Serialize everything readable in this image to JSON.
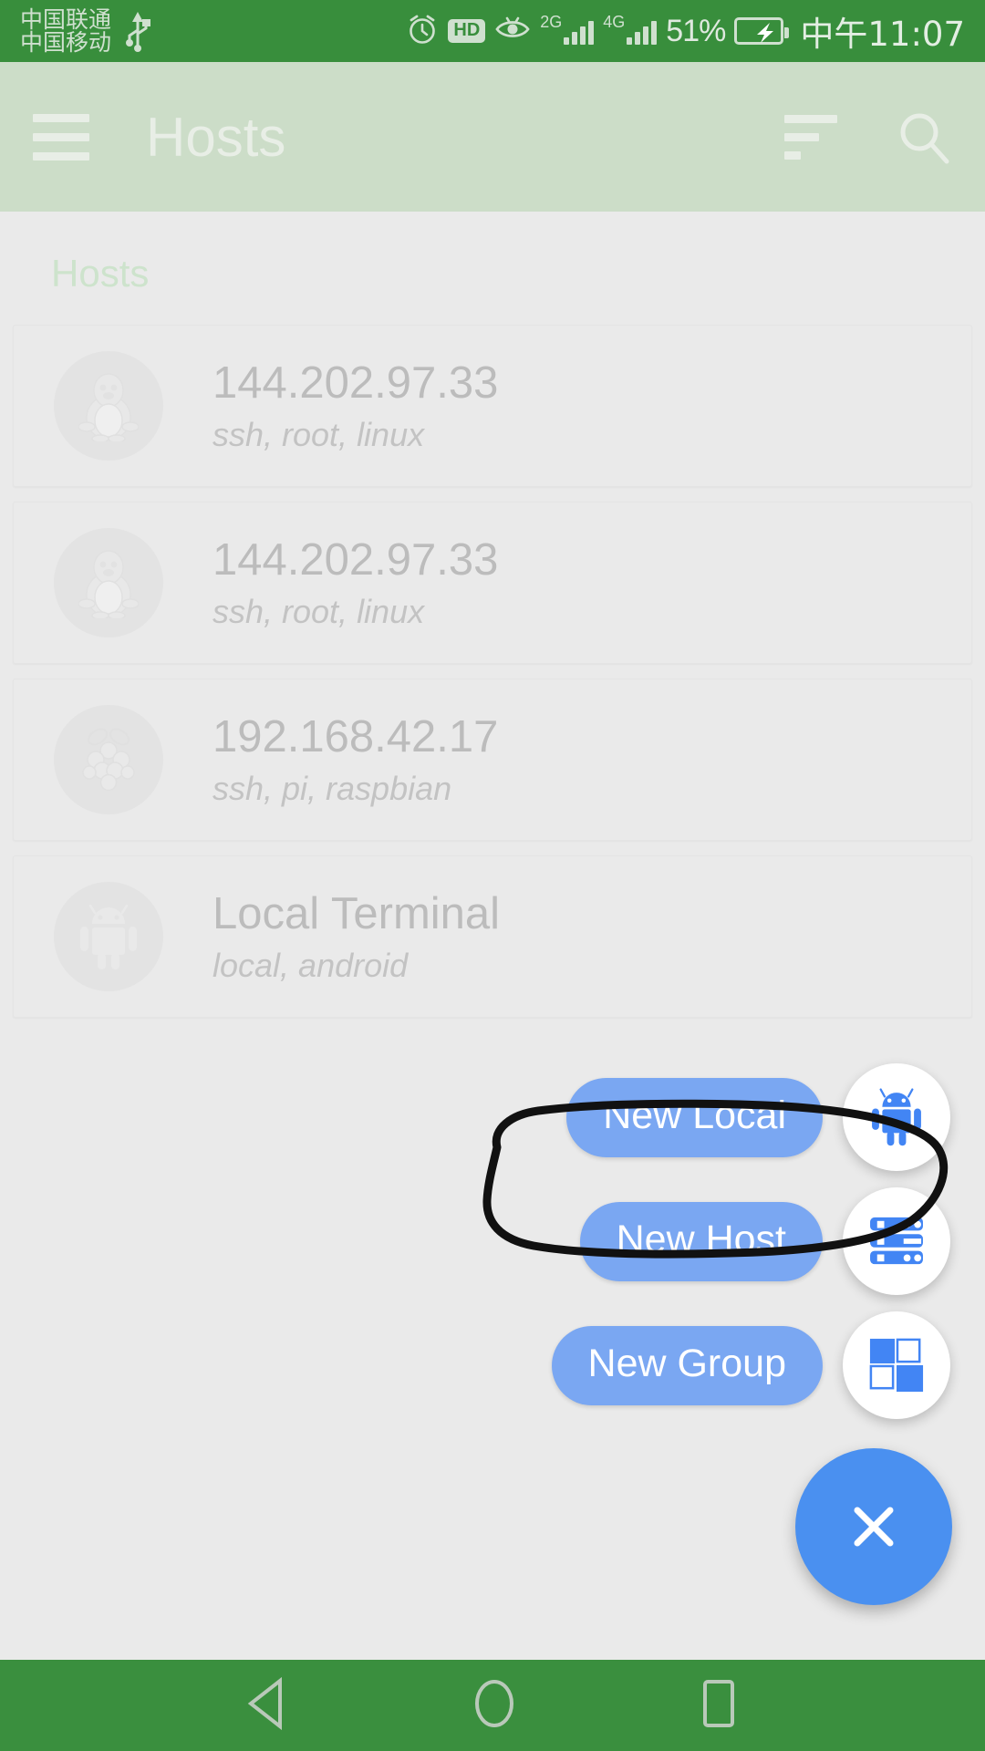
{
  "status_bar": {
    "carrier_primary": "中国联通",
    "carrier_secondary": "中国移动",
    "usb_icon": "usb-icon",
    "alarm_icon": "alarm-clock-icon",
    "hd_badge": "HD",
    "eye_icon": "eye-icon",
    "network_2g_label": "2G",
    "network_4g_label": "4G",
    "battery_percent": "51%",
    "battery_icon": "battery-charging-icon",
    "clock": "中午11:07"
  },
  "app_bar": {
    "menu_icon": "hamburger-menu-icon",
    "title": "Hosts",
    "sort_icon": "sort-icon",
    "search_icon": "search-icon"
  },
  "content": {
    "section_header": "Hosts",
    "hosts": [
      {
        "name": "144.202.97.33",
        "details": "ssh, root, linux",
        "icon": "tux-penguin-icon"
      },
      {
        "name": "144.202.97.33",
        "details": "ssh, root, linux",
        "icon": "tux-penguin-icon"
      },
      {
        "name": "192.168.42.17",
        "details": "ssh, pi, raspbian",
        "icon": "raspberry-pi-icon"
      },
      {
        "name": "Local Terminal",
        "details": "local, android",
        "icon": "android-robot-icon"
      }
    ]
  },
  "fab_menu": {
    "actions": [
      {
        "label": "New Local",
        "icon": "android-robot-icon"
      },
      {
        "label": "New Host",
        "icon": "server-rack-icon"
      },
      {
        "label": "New Group",
        "icon": "group-grid-icon"
      }
    ],
    "main_fab_icon": "close-icon"
  },
  "annotation": {
    "shape": "hand-drawn-ellipse-highlight",
    "target": "New Host",
    "stroke_color": "#111111"
  },
  "nav_bar": {
    "back_icon": "back-triangle-icon",
    "home_icon": "home-circle-icon",
    "recents_icon": "recents-square-icon"
  },
  "colors": {
    "status_bar_green": "#388e3c",
    "app_bar_green": "#ccddc8",
    "nav_bar_green": "#3a8f3e",
    "content_bg": "#eaeaea",
    "fab_blue": "#4a90f0",
    "fab_label_blue": "#7aa7f2",
    "icon_blue": "#4285f4"
  }
}
